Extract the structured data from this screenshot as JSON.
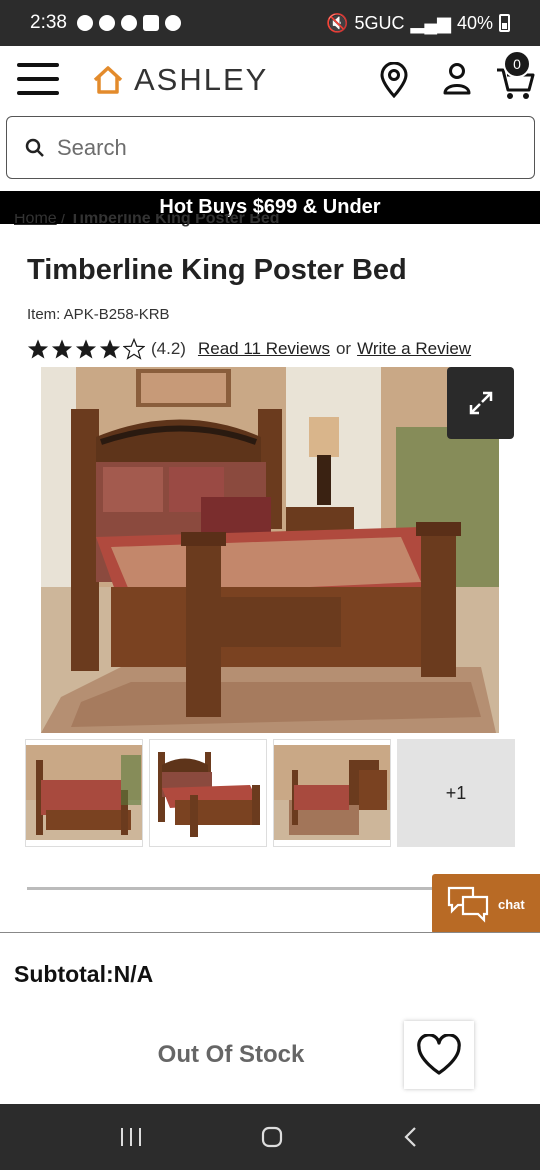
{
  "status_bar": {
    "time": "2:38",
    "network": "5GUC",
    "battery": "40%"
  },
  "header": {
    "brand": "ASHLEY",
    "cart_count": "0"
  },
  "search": {
    "placeholder": "Search"
  },
  "promo": {
    "text": "Hot Buys $699 & Under"
  },
  "breadcrumb": {
    "home": "Home",
    "separator": "/",
    "current": "Timberline King Poster Bed"
  },
  "product": {
    "title": "Timberline King Poster Bed",
    "item_number": "Item: APK-B258-KRB",
    "rating": 4.2,
    "rating_text": "(4.2)",
    "stars_filled": 4,
    "stars_total": 5,
    "reviews_link": "Read 11 Reviews",
    "or_text": "or",
    "write_review_link": "Write a Review"
  },
  "gallery": {
    "more_label": "+1"
  },
  "chat": {
    "label": "chat"
  },
  "checkout": {
    "subtotal": "Subtotal:N/A",
    "status_button": "Out Of Stock"
  },
  "colors": {
    "accent": "#e38b2c",
    "chat": "#b86a25",
    "promo_bg": "#000000"
  },
  "icons": [
    "menu-icon",
    "location-pin-icon",
    "user-icon",
    "cart-icon",
    "search-icon",
    "expand-icon",
    "chat-icon",
    "heart-icon"
  ]
}
